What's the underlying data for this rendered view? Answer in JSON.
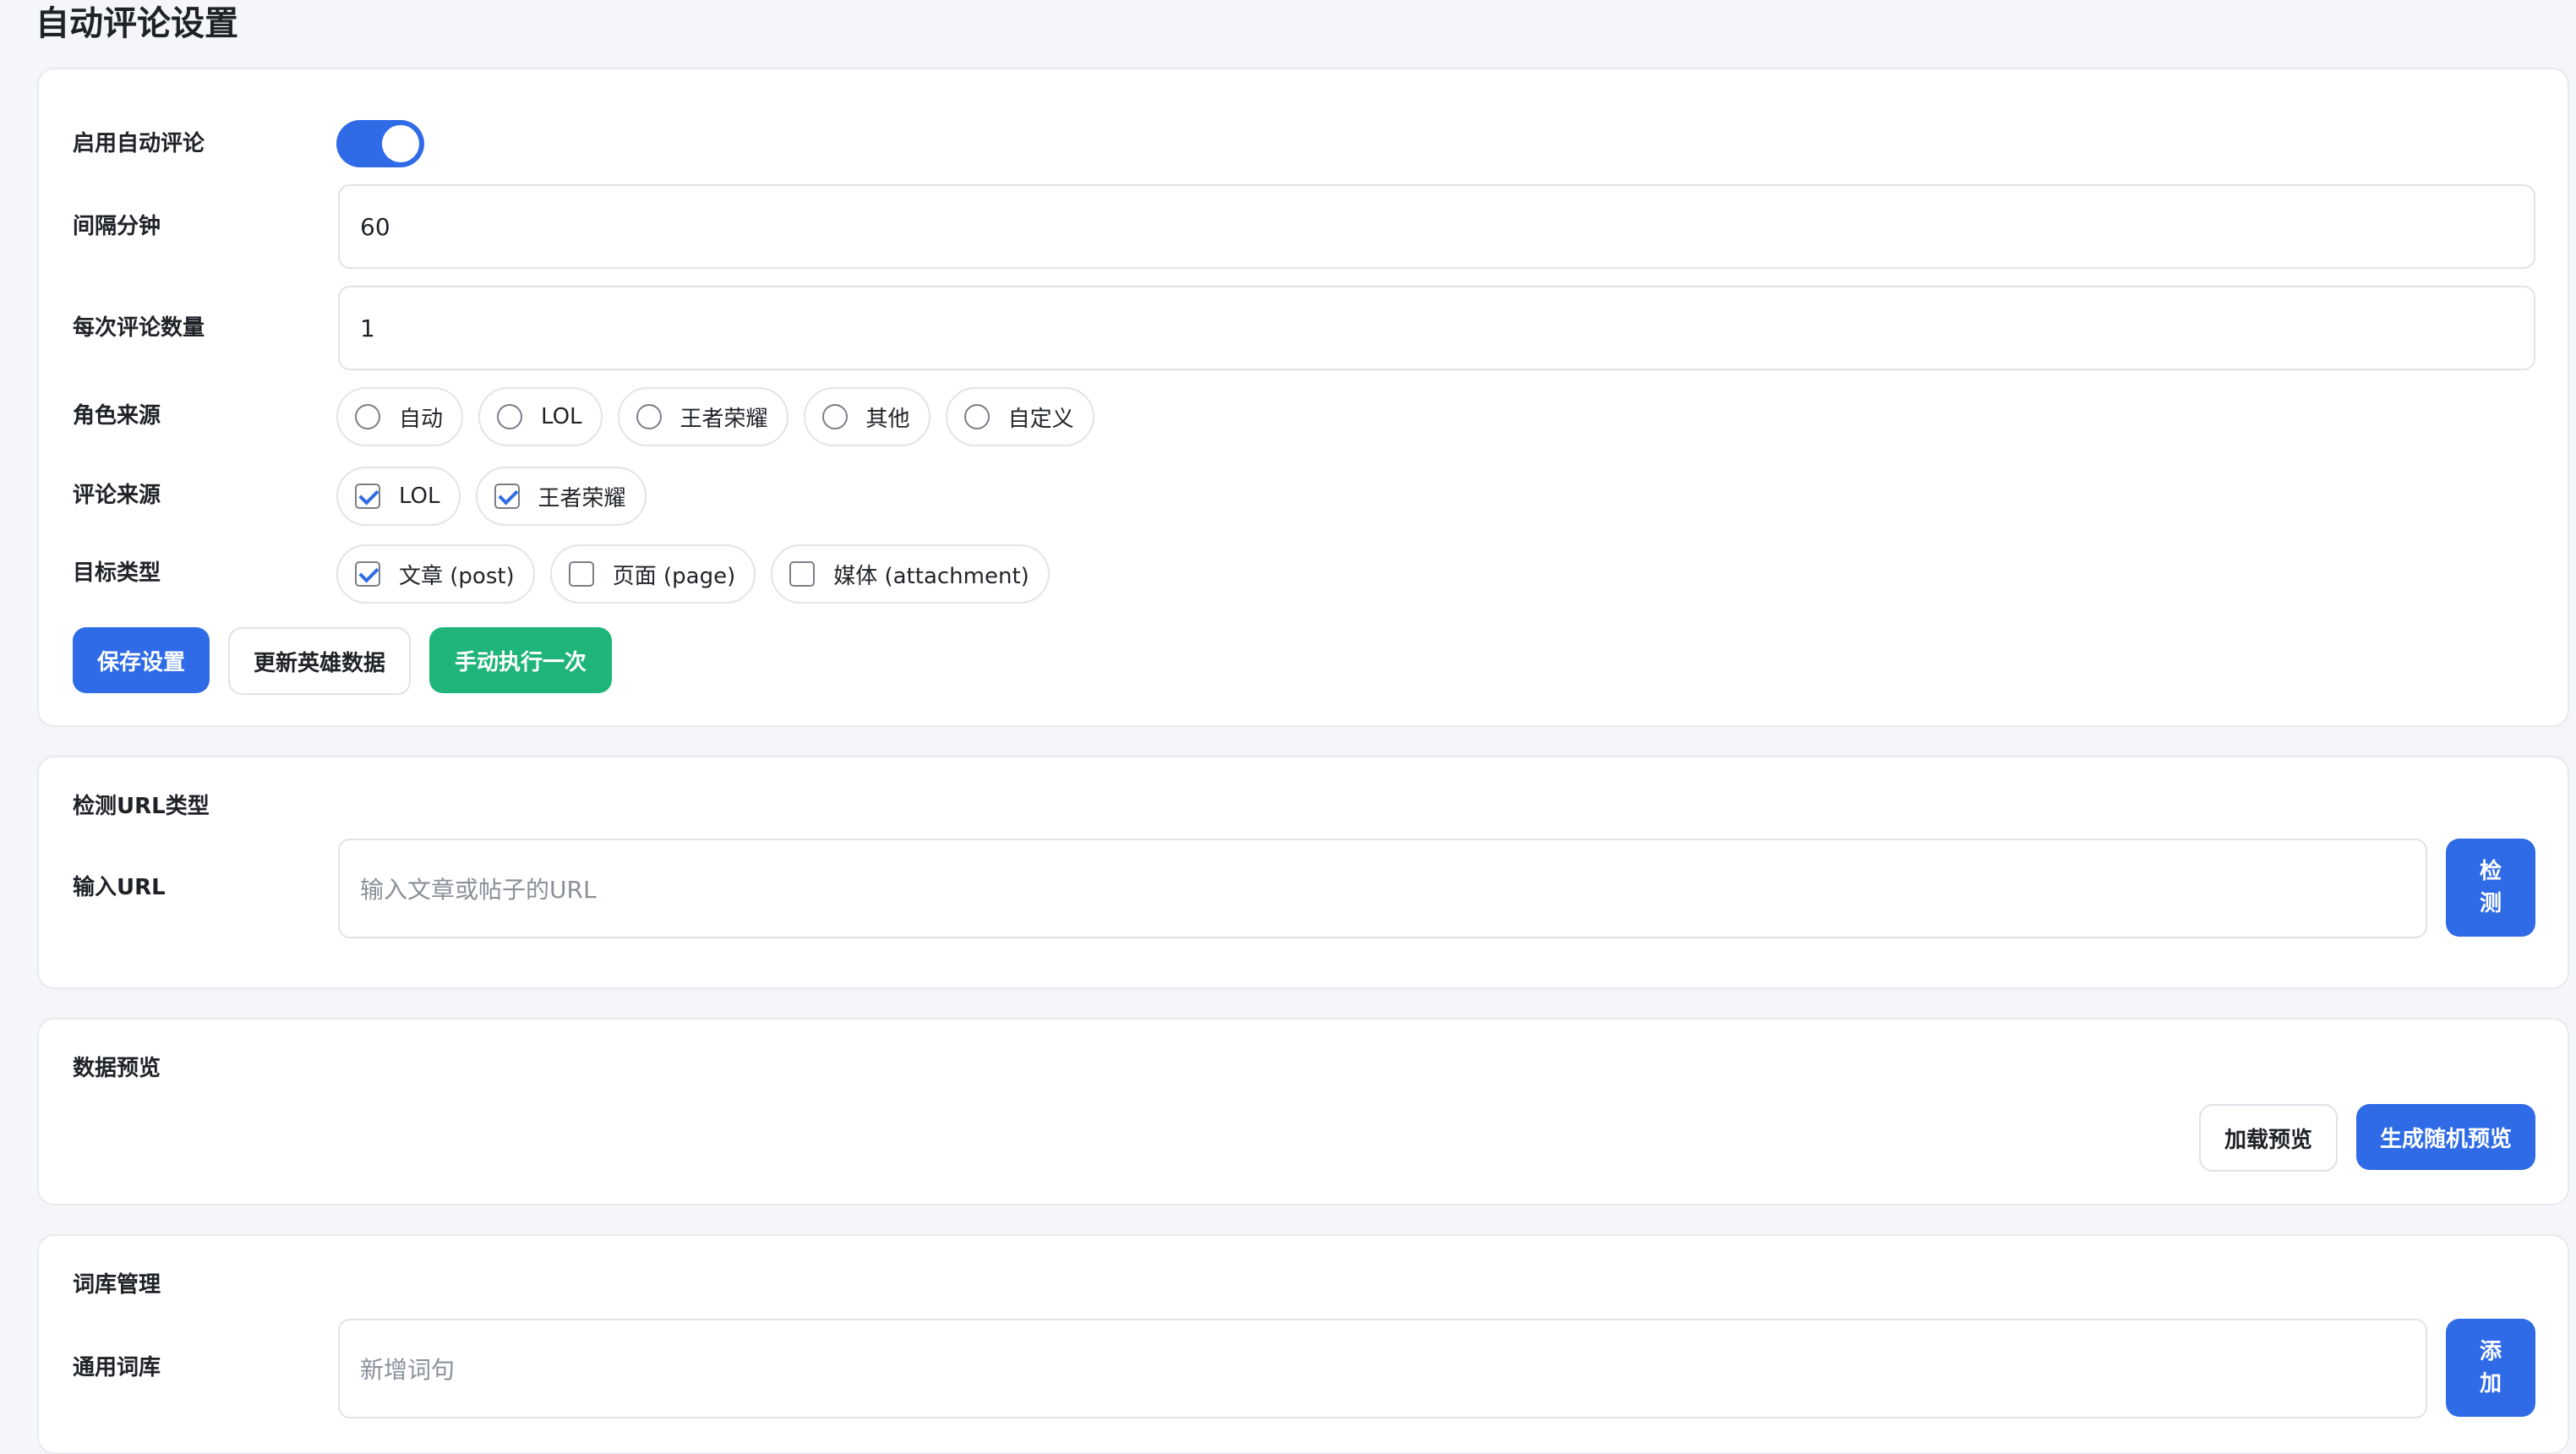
{
  "page": {
    "title": "自动评论设置"
  },
  "settings": {
    "enable_label": "启用自动评论",
    "enable_on": true,
    "interval_label": "间隔分钟",
    "interval_value": "60",
    "count_label": "每次评论数量",
    "count_value": "1",
    "role_source_label": "角色来源",
    "role_source_options": [
      "自动",
      "LOL",
      "王者荣耀",
      "其他",
      "自定义"
    ],
    "comment_source_label": "评论来源",
    "comment_source_options": [
      {
        "label": "LOL",
        "checked": true
      },
      {
        "label": "王者荣耀",
        "checked": true
      }
    ],
    "target_type_label": "目标类型",
    "target_type_options": [
      {
        "label": "文章 (post)",
        "checked": true
      },
      {
        "label": "页面 (page)",
        "checked": false
      },
      {
        "label": "媒体 (attachment)",
        "checked": false
      }
    ],
    "save_label": "保存设置",
    "update_heroes_label": "更新英雄数据",
    "run_once_label": "手动执行一次"
  },
  "detect": {
    "title": "检测URL类型",
    "input_label": "输入URL",
    "input_placeholder": "输入文章或帖子的URL",
    "button_line1": "检",
    "button_line2": "测"
  },
  "preview": {
    "title": "数据预览",
    "load_label": "加载预览",
    "random_label": "生成随机预览"
  },
  "lexicon": {
    "title": "词库管理",
    "general_label": "通用词库",
    "input_placeholder": "新增词句",
    "button_line1": "添",
    "button_line2": "加"
  },
  "colors": {
    "primary": "#2f6be6",
    "success": "#1fb57a",
    "background": "#f4f6f9"
  }
}
